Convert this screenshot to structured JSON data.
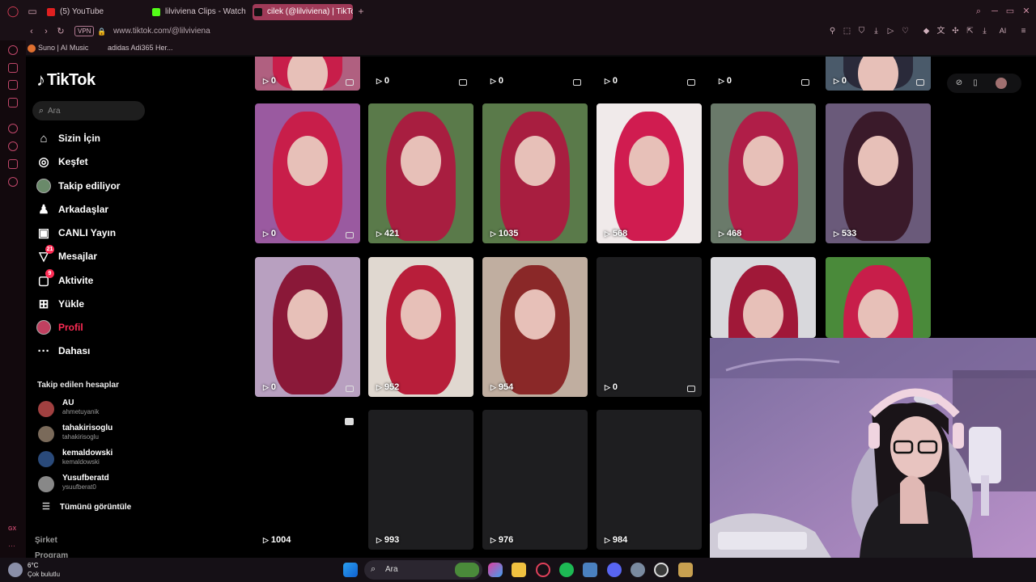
{
  "browser": {
    "tabs": [
      {
        "label": "(5) YouTube",
        "fav": "#e02020",
        "active": false
      },
      {
        "label": "lilviviena Clips - Watch Liv",
        "fav": "#53fc18",
        "active": false
      },
      {
        "label": "cilek (@lilviviena) | TikTok",
        "fav": "#111111",
        "active": true
      }
    ],
    "new_tab": "+",
    "url": "www.tiktok.com/@lilviviena",
    "vpn_label": "VPN",
    "ai_label": "AI",
    "bookmarks": [
      "Suno | AI Music",
      "adidas Adi365 Her..."
    ]
  },
  "sidebar": {
    "logo_text": "TikTok",
    "search_placeholder": "Ara",
    "nav": [
      {
        "label": "Sizin İçin",
        "icon": "home-icon",
        "glyph": "⌂",
        "badge": ""
      },
      {
        "label": "Keşfet",
        "icon": "compass-icon",
        "glyph": "◎",
        "badge": ""
      },
      {
        "label": "Takip ediliyor",
        "icon": "following-avatar",
        "glyph": "",
        "badge": ""
      },
      {
        "label": "Arkadaşlar",
        "icon": "friends-icon",
        "glyph": "♟",
        "badge": ""
      },
      {
        "label": "CANLI Yayın",
        "icon": "live-icon",
        "glyph": "▣",
        "badge": ""
      },
      {
        "label": "Mesajlar",
        "icon": "messages-icon",
        "glyph": "▽",
        "badge": "21"
      },
      {
        "label": "Aktivite",
        "icon": "activity-icon",
        "glyph": "▢",
        "badge": "9"
      },
      {
        "label": "Yükle",
        "icon": "upload-icon",
        "glyph": "⊞",
        "badge": ""
      },
      {
        "label": "Profil",
        "icon": "profile-avatar",
        "glyph": "",
        "badge": ""
      },
      {
        "label": "Dahası",
        "icon": "more-icon",
        "glyph": "···",
        "badge": ""
      }
    ],
    "following_title": "Takip edilen hesaplar",
    "accounts": [
      {
        "name": "AU",
        "handle": "ahmetuyanik",
        "color": "#a04040"
      },
      {
        "name": "tahakirisoglu",
        "handle": "tahakirisoglu",
        "color": "#7a6a5a"
      },
      {
        "name": "kemaldowski",
        "handle": "kemaldowski",
        "color": "#2a4a7a"
      },
      {
        "name": "Yusufberatd",
        "handle": "ysuufberat0",
        "color": "#888888"
      }
    ],
    "see_all": "Tümünü görüntüle",
    "company": "Şirket",
    "program": "Program"
  },
  "videos": {
    "rows": [
      [
        {
          "count": "0",
          "locked": true,
          "hair": "#c81e4a",
          "bg": "#b06080"
        },
        {
          "count": "0",
          "locked": true,
          "hair": "",
          "bg": "#000000"
        },
        {
          "count": "0",
          "locked": true,
          "hair": "",
          "bg": "#000000"
        },
        {
          "count": "0",
          "locked": true,
          "hair": "",
          "bg": "#000000"
        },
        {
          "count": "0",
          "locked": true,
          "hair": "",
          "bg": "#000000"
        },
        {
          "count": "0",
          "locked": true,
          "hair": "#2a2a3a",
          "bg": "#4a5a6a"
        }
      ],
      [
        {
          "count": "0",
          "locked": true,
          "hair": "#c81e4a",
          "bg": "#9a5aa0"
        },
        {
          "count": "421",
          "locked": false,
          "hair": "#a81e40",
          "bg": "#5a7a4a"
        },
        {
          "count": "1035",
          "locked": false,
          "hair": "#a81e40",
          "bg": "#5a7a4a"
        },
        {
          "count": "568",
          "locked": false,
          "hair": "#d01c50",
          "bg": "#f0eaea"
        },
        {
          "count": "468",
          "locked": false,
          "hair": "#b01e48",
          "bg": "#6a7a6a"
        },
        {
          "count": "533",
          "locked": false,
          "hair": "#3a1a2a",
          "bg": "#6a5a7a"
        }
      ],
      [
        {
          "count": "0",
          "locked": true,
          "hair": "#8a1838",
          "bg": "#b8a0c0"
        },
        {
          "count": "952",
          "locked": false,
          "hair": "#b81e3a",
          "bg": "#e0d8d0"
        },
        {
          "count": "954",
          "locked": false,
          "hair": "#8a2828",
          "bg": "#c0aea0"
        },
        {
          "count": "0",
          "locked": true,
          "hair": "",
          "bg": "#1e1e20"
        },
        {
          "count": "",
          "locked": false,
          "hair": "#a01838",
          "bg": "#d8d8dc"
        },
        {
          "count": "",
          "locked": false,
          "hair": "#c81e4a",
          "bg": "#4a8a3a"
        }
      ],
      [
        {
          "count": "1004",
          "locked": false,
          "hair": "",
          "bg": "#000000"
        },
        {
          "count": "993",
          "locked": false,
          "hair": "",
          "bg": "#1e1e20"
        },
        {
          "count": "976",
          "locked": false,
          "hair": "",
          "bg": "#1e1e20"
        },
        {
          "count": "984",
          "locked": false,
          "hair": "",
          "bg": "#1e1e20"
        }
      ]
    ]
  },
  "taskbar": {
    "temp": "6°C",
    "weather": "Çok bulutlu",
    "search_label": "Ara",
    "gx_label": "GX"
  },
  "colors": {
    "accent": "#fe2c55",
    "opera_red": "#c0476a"
  }
}
